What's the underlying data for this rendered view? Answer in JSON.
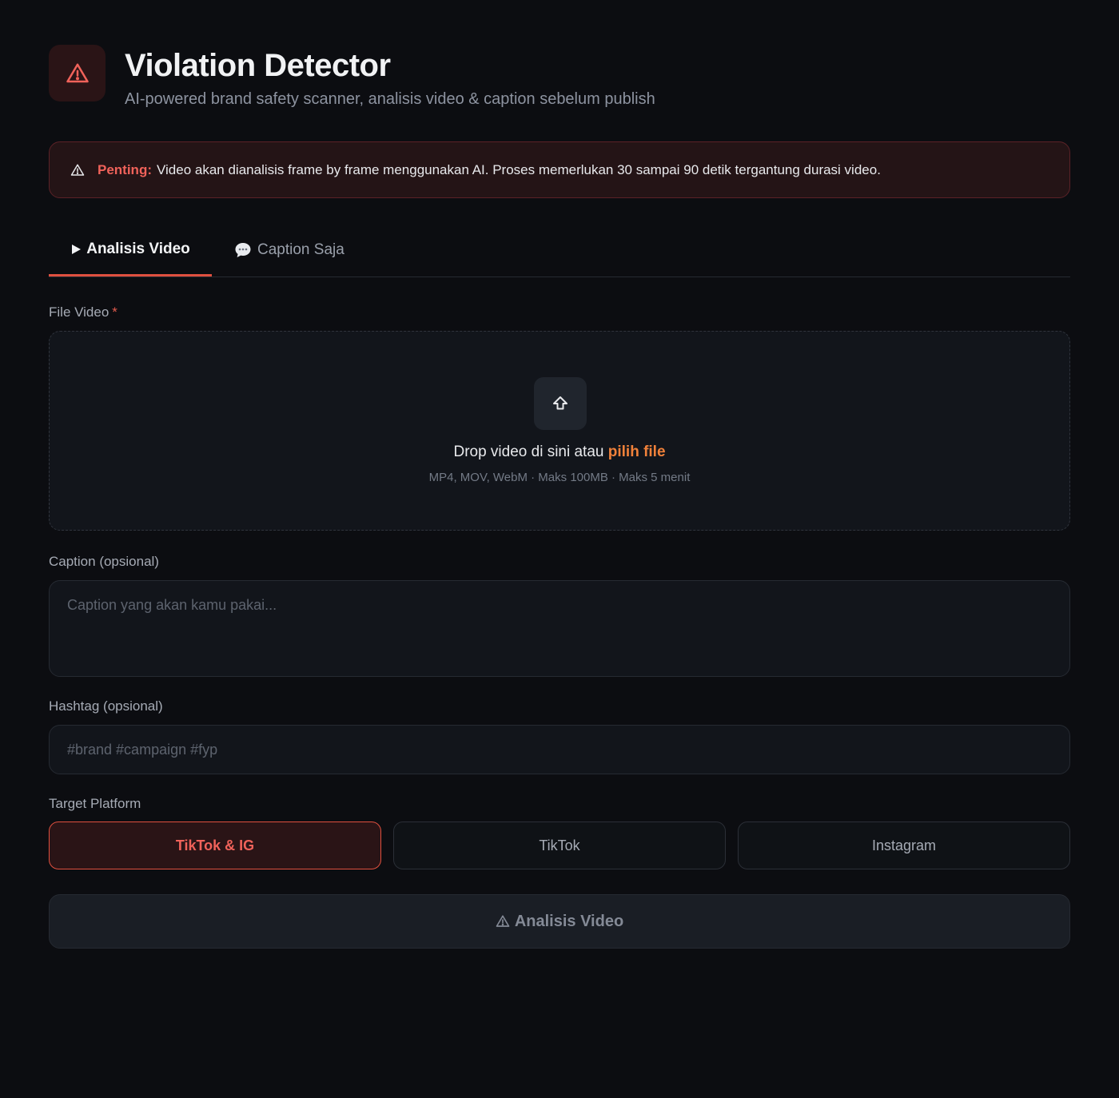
{
  "header": {
    "title": "Violation Detector",
    "subtitle": "AI-powered brand safety scanner, analisis video & caption sebelum publish",
    "logo_icon": "warning-triangle-icon"
  },
  "alert": {
    "icon": "warning-triangle-icon",
    "strong": "Penting:",
    "text": "Video akan dianalisis frame by frame menggunakan AI. Proses memerlukan 30 sampai 90 detik tergantung durasi video."
  },
  "tabs": [
    {
      "label": "Analisis Video",
      "icon": "play-icon",
      "active": true
    },
    {
      "label": "Caption Saja",
      "icon": "speech-bubble-icon",
      "active": false
    }
  ],
  "file_video": {
    "label": "File Video",
    "required_mark": "*",
    "drop_text": "Drop video di sini atau",
    "pick_text": "pilih file",
    "hint": "MP4, MOV, WebM · Maks 100MB · Maks 5 menit"
  },
  "caption": {
    "label": "Caption (opsional)",
    "placeholder": "Caption yang akan kamu pakai..."
  },
  "hashtag": {
    "label": "Hashtag (opsional)",
    "placeholder": "#brand #campaign #fyp"
  },
  "platform": {
    "label": "Target Platform",
    "options": [
      "TikTok & IG",
      "TikTok",
      "Instagram"
    ],
    "selected": "TikTok & IG"
  },
  "submit": {
    "label": "Analisis Video",
    "icon": "warning-triangle-icon"
  },
  "colors": {
    "background": "#0c0d11",
    "accent": "#e0503f",
    "link": "#f0813a",
    "alert_bg": "#241416"
  }
}
